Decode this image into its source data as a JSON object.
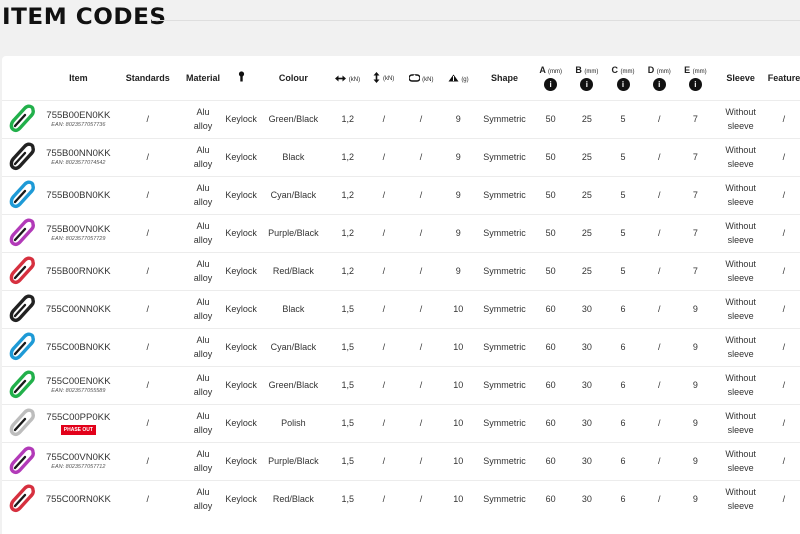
{
  "page": {
    "title": "ITEM CODES"
  },
  "table": {
    "headers": {
      "item": "Item",
      "standards": "Standards",
      "material": "Material",
      "colour": "Colour",
      "major_axis": "(kN)",
      "minor_axis": "(kN)",
      "gate_open": "(kN)",
      "weight": "(g)",
      "shape": "Shape",
      "a": "A",
      "a_unit": "(mm)",
      "b": "B",
      "b_unit": "(mm)",
      "c": "C",
      "c_unit": "(mm)",
      "d": "D",
      "d_unit": "(mm)",
      "e": "E",
      "e_unit": "(mm)",
      "sleeve": "Sleeve",
      "features": "Features",
      "info_glyph": "i"
    },
    "rows": [
      {
        "code": "755B00EN0KK",
        "ean": "EAN: 8023577057736",
        "phase": "",
        "color": "#22b04b",
        "standards": "/",
        "material_1": "Alu",
        "material_2": "alloy",
        "lock": "Keylock",
        "colour": "Green/Black",
        "major": "1,2",
        "minor": "/",
        "gate": "/",
        "weight": "9",
        "shape": "Symmetric",
        "a": "50",
        "b": "25",
        "c": "5",
        "d": "/",
        "e": "7",
        "sleeve_1": "Without",
        "sleeve_2": "sleeve",
        "features": "/"
      },
      {
        "code": "755B00NN0KK",
        "ean": "EAN: 8023577074542",
        "phase": "",
        "color": "#222222",
        "standards": "/",
        "material_1": "Alu",
        "material_2": "alloy",
        "lock": "Keylock",
        "colour": "Black",
        "major": "1,2",
        "minor": "/",
        "gate": "/",
        "weight": "9",
        "shape": "Symmetric",
        "a": "50",
        "b": "25",
        "c": "5",
        "d": "/",
        "e": "7",
        "sleeve_1": "Without",
        "sleeve_2": "sleeve",
        "features": "/"
      },
      {
        "code": "755B00BN0KK",
        "ean": "",
        "phase": "",
        "color": "#1e9ad6",
        "standards": "/",
        "material_1": "Alu",
        "material_2": "alloy",
        "lock": "Keylock",
        "colour": "Cyan/Black",
        "major": "1,2",
        "minor": "/",
        "gate": "/",
        "weight": "9",
        "shape": "Symmetric",
        "a": "50",
        "b": "25",
        "c": "5",
        "d": "/",
        "e": "7",
        "sleeve_1": "Without",
        "sleeve_2": "sleeve",
        "features": "/"
      },
      {
        "code": "755B00VN0KK",
        "ean": "EAN: 8023577057729",
        "phase": "",
        "color": "#b23ab8",
        "standards": "/",
        "material_1": "Alu",
        "material_2": "alloy",
        "lock": "Keylock",
        "colour": "Purple/Black",
        "major": "1,2",
        "minor": "/",
        "gate": "/",
        "weight": "9",
        "shape": "Symmetric",
        "a": "50",
        "b": "25",
        "c": "5",
        "d": "/",
        "e": "7",
        "sleeve_1": "Without",
        "sleeve_2": "sleeve",
        "features": "/"
      },
      {
        "code": "755B00RN0KK",
        "ean": "",
        "phase": "",
        "color": "#d6303f",
        "standards": "/",
        "material_1": "Alu",
        "material_2": "alloy",
        "lock": "Keylock",
        "colour": "Red/Black",
        "major": "1,2",
        "minor": "/",
        "gate": "/",
        "weight": "9",
        "shape": "Symmetric",
        "a": "50",
        "b": "25",
        "c": "5",
        "d": "/",
        "e": "7",
        "sleeve_1": "Without",
        "sleeve_2": "sleeve",
        "features": "/"
      },
      {
        "code": "755C00NN0KK",
        "ean": "",
        "phase": "",
        "color": "#222222",
        "standards": "/",
        "material_1": "Alu",
        "material_2": "alloy",
        "lock": "Keylock",
        "colour": "Black",
        "major": "1,5",
        "minor": "/",
        "gate": "/",
        "weight": "10",
        "shape": "Symmetric",
        "a": "60",
        "b": "30",
        "c": "6",
        "d": "/",
        "e": "9",
        "sleeve_1": "Without",
        "sleeve_2": "sleeve",
        "features": "/"
      },
      {
        "code": "755C00BN0KK",
        "ean": "",
        "phase": "",
        "color": "#1e9ad6",
        "standards": "/",
        "material_1": "Alu",
        "material_2": "alloy",
        "lock": "Keylock",
        "colour": "Cyan/Black",
        "major": "1,5",
        "minor": "/",
        "gate": "/",
        "weight": "10",
        "shape": "Symmetric",
        "a": "60",
        "b": "30",
        "c": "6",
        "d": "/",
        "e": "9",
        "sleeve_1": "Without",
        "sleeve_2": "sleeve",
        "features": "/"
      },
      {
        "code": "755C00EN0KK",
        "ean": "EAN: 8023577055589",
        "phase": "",
        "color": "#22b04b",
        "standards": "/",
        "material_1": "Alu",
        "material_2": "alloy",
        "lock": "Keylock",
        "colour": "Green/Black",
        "major": "1,5",
        "minor": "/",
        "gate": "/",
        "weight": "10",
        "shape": "Symmetric",
        "a": "60",
        "b": "30",
        "c": "6",
        "d": "/",
        "e": "9",
        "sleeve_1": "Without",
        "sleeve_2": "sleeve",
        "features": "/"
      },
      {
        "code": "755C00PP0KK",
        "ean": "",
        "phase": "PHASE OUT",
        "color": "#bdbdbd",
        "standards": "/",
        "material_1": "Alu",
        "material_2": "alloy",
        "lock": "Keylock",
        "colour": "Polish",
        "major": "1,5",
        "minor": "/",
        "gate": "/",
        "weight": "10",
        "shape": "Symmetric",
        "a": "60",
        "b": "30",
        "c": "6",
        "d": "/",
        "e": "9",
        "sleeve_1": "Without",
        "sleeve_2": "sleeve",
        "features": "/"
      },
      {
        "code": "755C00VN0KK",
        "ean": "EAN: 8023577057712",
        "phase": "",
        "color": "#b23ab8",
        "standards": "/",
        "material_1": "Alu",
        "material_2": "alloy",
        "lock": "Keylock",
        "colour": "Purple/Black",
        "major": "1,5",
        "minor": "/",
        "gate": "/",
        "weight": "10",
        "shape": "Symmetric",
        "a": "60",
        "b": "30",
        "c": "6",
        "d": "/",
        "e": "9",
        "sleeve_1": "Without",
        "sleeve_2": "sleeve",
        "features": "/"
      },
      {
        "code": "755C00RN0KK",
        "ean": "",
        "phase": "",
        "color": "#d6303f",
        "standards": "/",
        "material_1": "Alu",
        "material_2": "alloy",
        "lock": "Keylock",
        "colour": "Red/Black",
        "major": "1,5",
        "minor": "/",
        "gate": "/",
        "weight": "10",
        "shape": "Symmetric",
        "a": "60",
        "b": "30",
        "c": "6",
        "d": "/",
        "e": "9",
        "sleeve_1": "Without",
        "sleeve_2": "sleeve",
        "features": "/"
      }
    ]
  }
}
